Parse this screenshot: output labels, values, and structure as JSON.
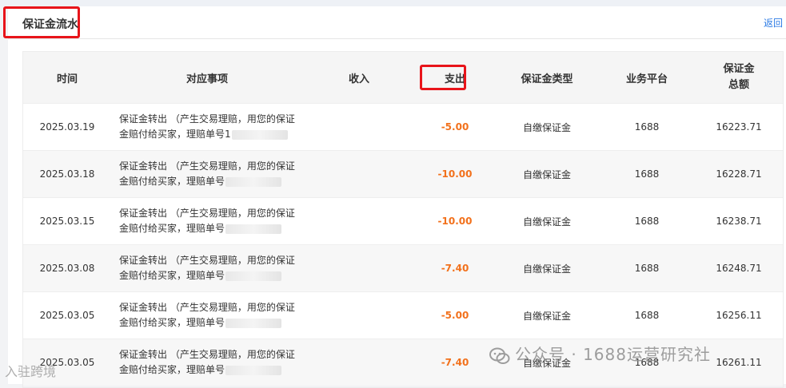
{
  "page": {
    "title": "保证金流水",
    "back_label": "返回"
  },
  "table": {
    "headers": {
      "time": "时间",
      "item": "对应事项",
      "income": "收入",
      "expense": "支出",
      "type": "保证金类型",
      "platform": "业务平台",
      "total": "保证金总额"
    },
    "rows": [
      {
        "time": "2025.03.19",
        "desc_line1": "保证金转出 （产生交易理赔，用您的保证",
        "desc_line2": "金赔付给买家，理赔单号1",
        "income": "",
        "expense": "-5.00",
        "type": "自缴保证金",
        "platform": "1688",
        "total": "16223.71"
      },
      {
        "time": "2025.03.18",
        "desc_line1": "保证金转出 （产生交易理赔，用您的保证",
        "desc_line2": "金赔付给买家，理赔单号",
        "income": "",
        "expense": "-10.00",
        "type": "自缴保证金",
        "platform": "1688",
        "total": "16228.71"
      },
      {
        "time": "2025.03.15",
        "desc_line1": "保证金转出 （产生交易理赔，用您的保证",
        "desc_line2": "金赔付给买家，理赔单号",
        "income": "",
        "expense": "-10.00",
        "type": "自缴保证金",
        "platform": "1688",
        "total": "16238.71"
      },
      {
        "time": "2025.03.08",
        "desc_line1": "保证金转出 （产生交易理赔，用您的保证",
        "desc_line2": "金赔付给买家，理赔单号",
        "income": "",
        "expense": "-7.40",
        "type": "自缴保证金",
        "platform": "1688",
        "total": "16248.71"
      },
      {
        "time": "2025.03.05",
        "desc_line1": "保证金转出 （产生交易理赔，用您的保证",
        "desc_line2": "金赔付给买家，理赔单号",
        "income": "",
        "expense": "-5.00",
        "type": "自缴保证金",
        "platform": "1688",
        "total": "16256.11"
      },
      {
        "time": "2025.03.05",
        "desc_line1": "保证金转出 （产生交易理赔，用您的保证",
        "desc_line2": "金赔付给买家，理赔单号",
        "income": "",
        "expense": "-7.40",
        "type": "自缴保证金",
        "platform": "1688",
        "total": "16261.11"
      }
    ]
  },
  "watermarks": {
    "right": "公众号 · 1688运营研究社",
    "left": "入驻跨境"
  },
  "colors": {
    "highlight_box": "#e8141a",
    "expense_text": "#f2711c",
    "link": "#2c7be5"
  }
}
